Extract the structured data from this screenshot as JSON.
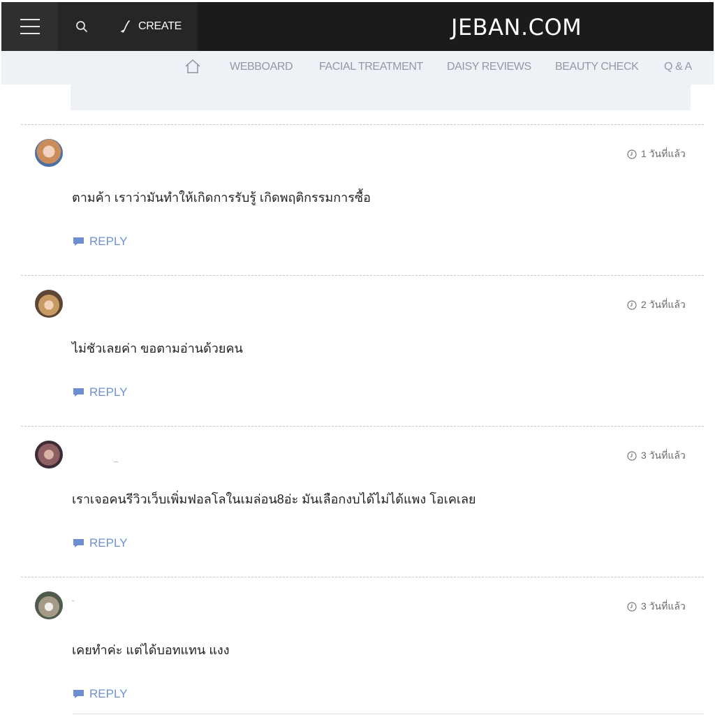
{
  "header": {
    "create_label": "CREATE",
    "logo_text": "JEBAN.COM",
    "icons": {
      "menu": "hamburger-menu-icon",
      "search": "search-icon",
      "create": "pen-icon"
    }
  },
  "nav": {
    "home_icon": "home-icon",
    "items": [
      {
        "label": "WEBBOARD"
      },
      {
        "label": "FACIAL TREATMENT"
      },
      {
        "label": "DAISY REVIEWS"
      },
      {
        "label": "BEAUTY CHECK"
      },
      {
        "label": "Q & A"
      }
    ]
  },
  "comments": [
    {
      "time": "1 วันที่แล้ว",
      "text": "ตามค้า เราว่ามันทำให้เกิดการรับรู้ เกิดพฤติกรรมการซื้อ",
      "reply_label": "REPLY"
    },
    {
      "time": "2 วันที่แล้ว",
      "text": "ไม่ชัวเลยค่า ขอตามอ่านด้วยคน",
      "reply_label": "REPLY"
    },
    {
      "time": "3 วันที่แล้ว",
      "text": "เราเจอคนรีวิวเว็บเพิ่มฟอลโลในเมล่อน8อ่ะ มันเลือกงบได้ไม่ได้แพง โอเคเลย",
      "reply_label": "REPLY"
    },
    {
      "time": "3 วันที่แล้ว",
      "text": "เคยทำค่ะ แต่ได้บอทแทน แงง",
      "reply_label": "REPLY"
    }
  ],
  "colors": {
    "topbar": "#1b1b1b",
    "subnav": "#eef2f6",
    "reply": "#6d8fd2"
  }
}
